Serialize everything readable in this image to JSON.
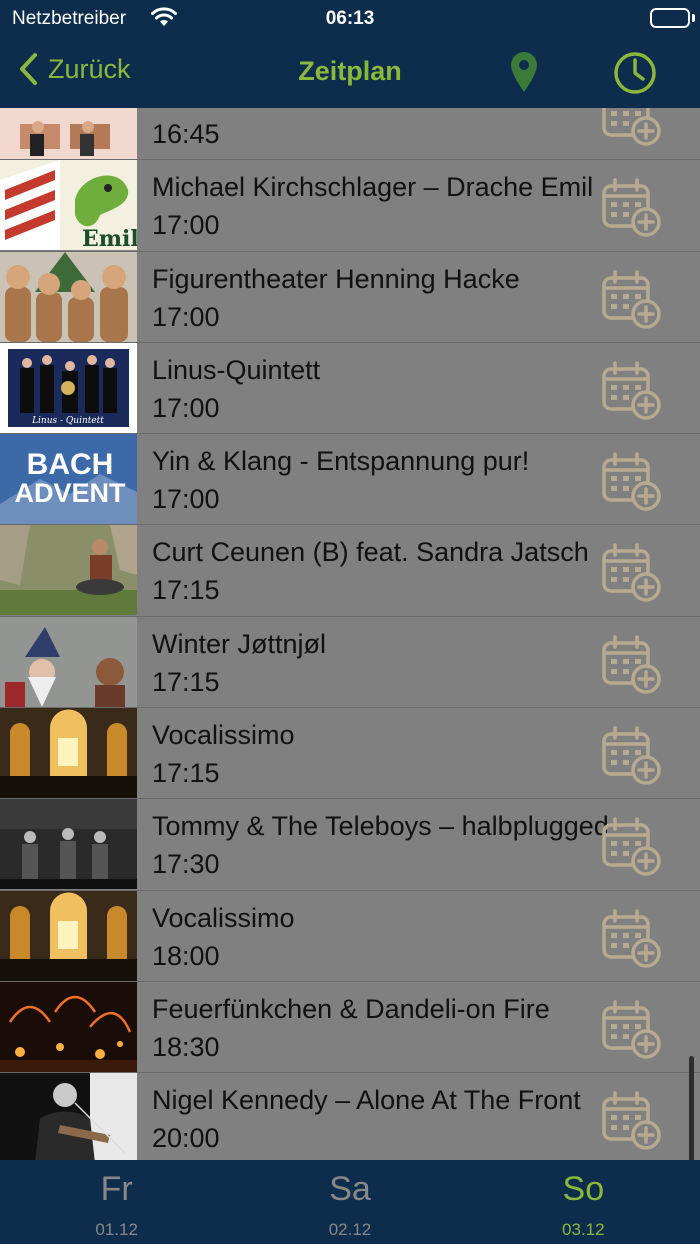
{
  "status": {
    "carrier": "Netzbetreiber",
    "time": "06:13"
  },
  "nav": {
    "back_label": "Zurück",
    "title": "Zeitplan"
  },
  "colors": {
    "accent": "#8ab83a",
    "bar": "#0e2d4c",
    "row_bg": "#808080",
    "icon_muted": "#b8aa90"
  },
  "events": [
    {
      "title": "",
      "time": "16:45",
      "thumb": "people-on-chairs"
    },
    {
      "title": "Michael Kirchschlager – Drache Emil",
      "time": "17:00",
      "thumb": "dragon-emil",
      "thumb_text": "Emil"
    },
    {
      "title": "Figurentheater Henning Hacke",
      "time": "17:00",
      "thumb": "wooden-puppets"
    },
    {
      "title": "Linus-Quintett",
      "time": "17:00",
      "thumb": "brass-quintet",
      "thumb_text": "Linus - Quintett"
    },
    {
      "title": "Yin & Klang - Entspannung pur!",
      "time": "17:00",
      "thumb": "bach-advent",
      "thumb_text": "BACH ADVENT"
    },
    {
      "title": "Curt Ceunen (B) feat. Sandra Jatsch",
      "time": "17:15",
      "thumb": "handpan-player"
    },
    {
      "title": "Winter Jøttnjøl",
      "time": "17:15",
      "thumb": "troll-puppets"
    },
    {
      "title": "Vocalissimo",
      "time": "17:15",
      "thumb": "church-concert"
    },
    {
      "title": "Tommy & The Teleboys – halbplugged",
      "time": "17:30",
      "thumb": "band-stage"
    },
    {
      "title": "Vocalissimo",
      "time": "18:00",
      "thumb": "church-concert"
    },
    {
      "title": "Feuerfünkchen & Dandeli-on Fire",
      "time": "18:30",
      "thumb": "fire-show"
    },
    {
      "title": "Nigel Kennedy – Alone At The Front",
      "time": "20:00",
      "thumb": "violinist"
    }
  ],
  "tabs": [
    {
      "day": "Fr",
      "date": "01.12",
      "active": false
    },
    {
      "day": "Sa",
      "date": "02.12",
      "active": false
    },
    {
      "day": "So",
      "date": "03.12",
      "active": true
    }
  ]
}
